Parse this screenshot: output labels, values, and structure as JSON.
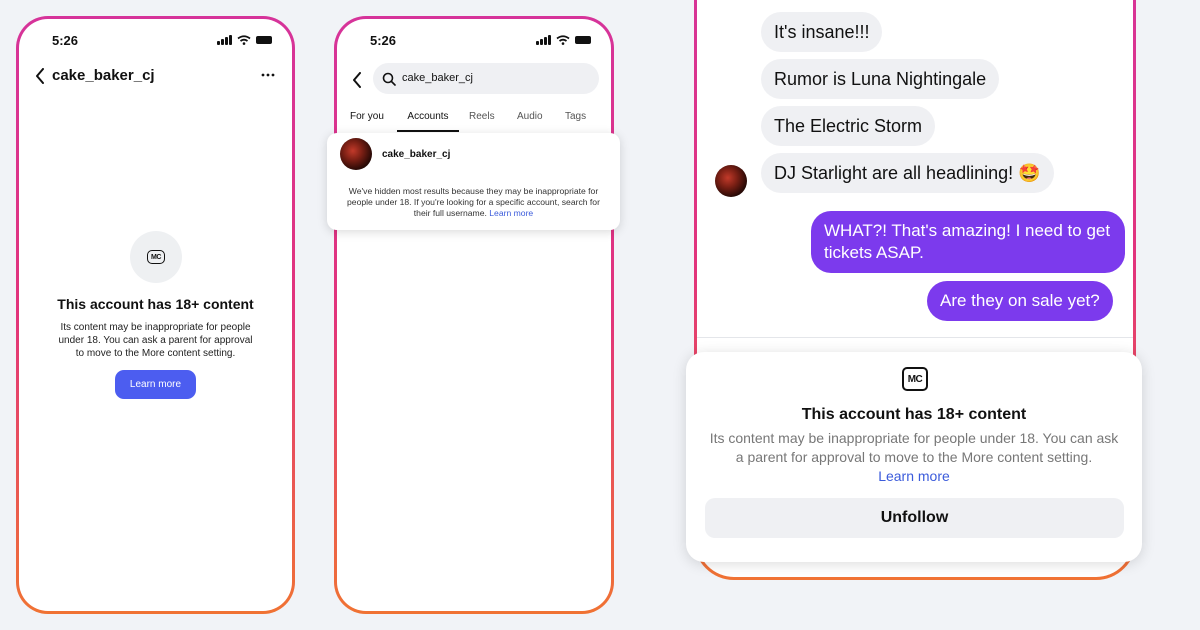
{
  "phone1": {
    "time": "5:26",
    "header_title": "cake_baker_cj",
    "badge": "MC",
    "title": "This account has 18+ content",
    "body": "Its content may be inappropriate for people under 18. You can ask a parent for approval to move to the More content setting.",
    "button_label": "Learn more"
  },
  "phone2": {
    "time": "5:26",
    "search_value": "cake_baker_cj",
    "tabs": [
      "For you",
      "Accounts",
      "Reels",
      "Audio",
      "Tags"
    ],
    "active_tab": "Accounts",
    "result_username": "cake_baker_cj",
    "notice_text": "We've hidden most results because they may be inappropriate for people under 18. If you're looking for a specific account, search for their full username.",
    "notice_link": "Learn more"
  },
  "chat": {
    "messages": [
      {
        "text": "It's insane!!!",
        "from": "them"
      },
      {
        "text": "Rumor is Luna Nightingale",
        "from": "them"
      },
      {
        "text": "The Electric Storm",
        "from": "them"
      },
      {
        "text": "DJ Starlight are all headlining! 🤩",
        "from": "them"
      },
      {
        "text": "WHAT?! That's amazing! I need to get tickets ASAP.",
        "from": "me"
      },
      {
        "text": "Are they on sale yet?",
        "from": "me"
      }
    ],
    "my_bubble_color": "#7c3aed"
  },
  "sheet": {
    "badge": "MC",
    "title": "This account has 18+ content",
    "body": "Its content may be inappropriate for people under 18. You can ask a parent for approval to move to the More content setting.",
    "link": "Learn more",
    "button_label": "Unfollow"
  },
  "colors": {
    "border_gradient": [
      "#d6339a",
      "#f07233"
    ],
    "primary_button": "#4c5df0",
    "background": "#f1f3f7"
  }
}
